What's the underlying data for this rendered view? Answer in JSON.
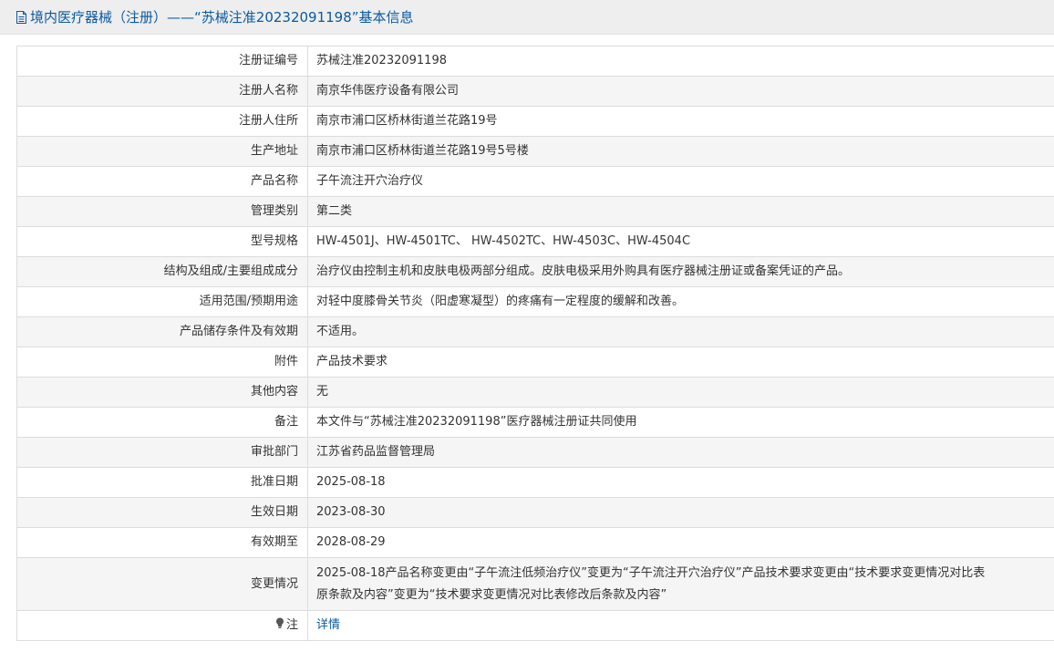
{
  "header": {
    "title": "境内医疗器械（注册）——“苏械注准20232091198”基本信息",
    "icon": "document-icon"
  },
  "rows": [
    {
      "label": "注册证编号",
      "value": "苏械注准20232091198"
    },
    {
      "label": "注册人名称",
      "value": "南京华伟医疗设备有限公司"
    },
    {
      "label": "注册人住所",
      "value": "南京市浦口区桥林街道兰花路19号"
    },
    {
      "label": "生产地址",
      "value": "南京市浦口区桥林街道兰花路19号5号楼"
    },
    {
      "label": "产品名称",
      "value": "子午流注开穴治疗仪"
    },
    {
      "label": "管理类别",
      "value": "第二类"
    },
    {
      "label": "型号规格",
      "value": "HW-4501J、HW-4501TC、 HW-4502TC、HW-4503C、HW-4504C"
    },
    {
      "label": "结构及组成/主要组成成分",
      "value": "治疗仪由控制主机和皮肤电极两部分组成。皮肤电极采用外购具有医疗器械注册证或备案凭证的产品。"
    },
    {
      "label": "适用范围/预期用途",
      "value": "对轻中度膝骨关节炎（阳虚寒凝型）的疼痛有一定程度的缓解和改善。"
    },
    {
      "label": "产品储存条件及有效期",
      "value": "不适用。"
    },
    {
      "label": "附件",
      "value": "产品技术要求"
    },
    {
      "label": "其他内容",
      "value": "无"
    },
    {
      "label": "备注",
      "value": "本文件与“苏械注准20232091198”医疗器械注册证共同使用"
    },
    {
      "label": "审批部门",
      "value": "江苏省药品监督管理局"
    },
    {
      "label": "批准日期",
      "value": "2025-08-18"
    },
    {
      "label": "生效日期",
      "value": "2023-08-30"
    },
    {
      "label": "有效期至",
      "value": "2028-08-29"
    },
    {
      "label": "变更情况",
      "value_line1": "2025-08-18产品名称变更由“子午流注低频治疗仪”变更为“子午流注开穴治疗仪”产品技术要求变更由“技术要求变更情况对比表",
      "value_line2": "原条款及内容”变更为“技术要求变更情况对比表修改后条款及内容”"
    },
    {
      "label": "注",
      "value": "详情",
      "icon": "lightbulb-icon"
    }
  ],
  "colors": {
    "title_text": "#0b5aa0",
    "title_bar_bg": "#eeeeee",
    "alt_row_bg": "#f5f5f5",
    "border": "#dcdcdc",
    "link": "#0b5aa0"
  }
}
